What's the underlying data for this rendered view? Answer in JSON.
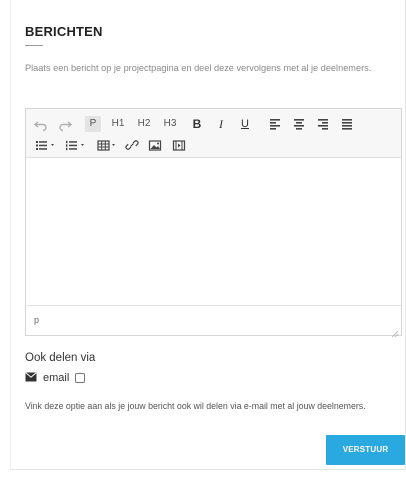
{
  "section": {
    "title": "BERICHTEN",
    "intro": "Plaats een bericht op je projectpagina en deel deze vervolgens met al je deelnemers."
  },
  "editor": {
    "toolbar": {
      "undo_icon": "undo-icon",
      "redo_icon": "redo-icon",
      "paragraph_label": "P",
      "h1_label": "H1",
      "h2_label": "H2",
      "h3_label": "H3",
      "bold_label": "B",
      "italic_label": "I",
      "underline_label": "U",
      "align_icons": [
        "align-left-icon",
        "align-center-icon",
        "align-right-icon",
        "align-justify-icon"
      ],
      "list_icons": [
        "bullet-list-icon",
        "numbered-list-icon"
      ],
      "table_icon": "table-icon",
      "link_icon": "link-icon",
      "image_icon": "image-icon",
      "media_icon": "media-icon"
    },
    "content": "",
    "status_path": "p"
  },
  "share": {
    "title": "Ook delen via",
    "email_label": "email",
    "email_checked": false,
    "note": "Vink deze optie aan als je jouw bericht ook wil delen via e-mail met al jouw deelnemers."
  },
  "submit": {
    "label": "VERSTUUR"
  },
  "colors": {
    "accent": "#2aa8e0",
    "toolbar_bg": "#f7f7f7",
    "border": "#d6d6d6"
  }
}
